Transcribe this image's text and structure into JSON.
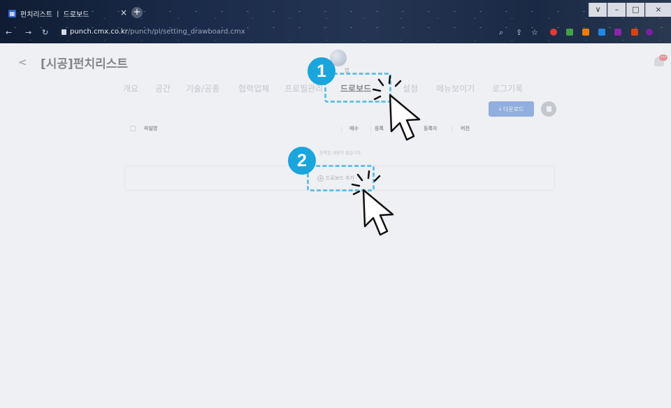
{
  "browser": {
    "tab_title": "펀치리스트 ㅣ 드로보드",
    "tab_close": "×",
    "new_tab": "+",
    "url_host": "punch.cmx.co.kr",
    "url_path": "/punch/pl/setting_drawboard.cmx",
    "window_controls": [
      "∨",
      "–",
      "□",
      "×"
    ]
  },
  "header": {
    "back": "<",
    "title": "[시공]펀치리스트",
    "avatar_label": "앱"
  },
  "tabs": [
    {
      "label": "개요",
      "active": false
    },
    {
      "label": "공간",
      "active": false
    },
    {
      "label": "기술/공종",
      "active": false
    },
    {
      "label": "협력업체",
      "active": false
    },
    {
      "label": "프로필관리",
      "active": false
    },
    {
      "label": "드로보드",
      "active": true
    },
    {
      "label": "설정",
      "active": false
    },
    {
      "label": "메뉴보이기",
      "active": false
    },
    {
      "label": "로그기록",
      "active": false
    }
  ],
  "toolbar": {
    "download_label": "다운로드",
    "download_icon": "download-icon",
    "delete_icon": "trash-icon"
  },
  "table": {
    "columns": [
      "파일명",
      "매수",
      "등록",
      "등록자",
      "버전"
    ],
    "empty_message": "등록된 내용이 없습니다.",
    "add_label": "드로보드 추가"
  },
  "annotations": {
    "step1": "1",
    "step2": "2"
  },
  "colors": {
    "accent": "#2f6fd0",
    "badge": "#1aa5dc",
    "highlight": "#66c1e6"
  }
}
